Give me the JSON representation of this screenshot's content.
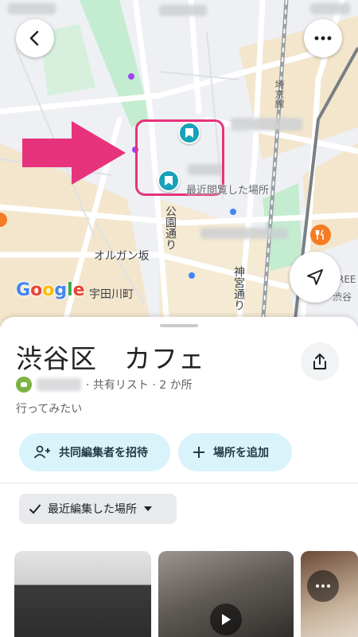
{
  "map": {
    "labels": {
      "organ_zaka": "オルガン坂",
      "udagawacho": "宇田川町",
      "koen_dori": "公園通り",
      "jingu_dori": "神宮通り",
      "saikyo_line": "埼京線",
      "shibuya_partial": "渋谷",
      "ree_partial": "REE"
    },
    "recently_viewed_label": "最近閲覧した場所",
    "logo": [
      "G",
      "o",
      "o",
      "g",
      "l",
      "e"
    ]
  },
  "buttons": {
    "back": "back-arrow-icon",
    "more": "more-dots-icon",
    "locate": "navigation-arrow-icon"
  },
  "list": {
    "title": "渋谷区　カフェ",
    "meta": "· 共有リスト · 2 か所",
    "description": "行ってみたい",
    "invite_label": "共同編集者を招待",
    "add_place_label": "場所を追加",
    "sort_label": "最近編集した場所"
  },
  "colors": {
    "pin": "#17a2b8",
    "highlight": "#e7327c",
    "pill_bg": "#d9f3fa"
  }
}
